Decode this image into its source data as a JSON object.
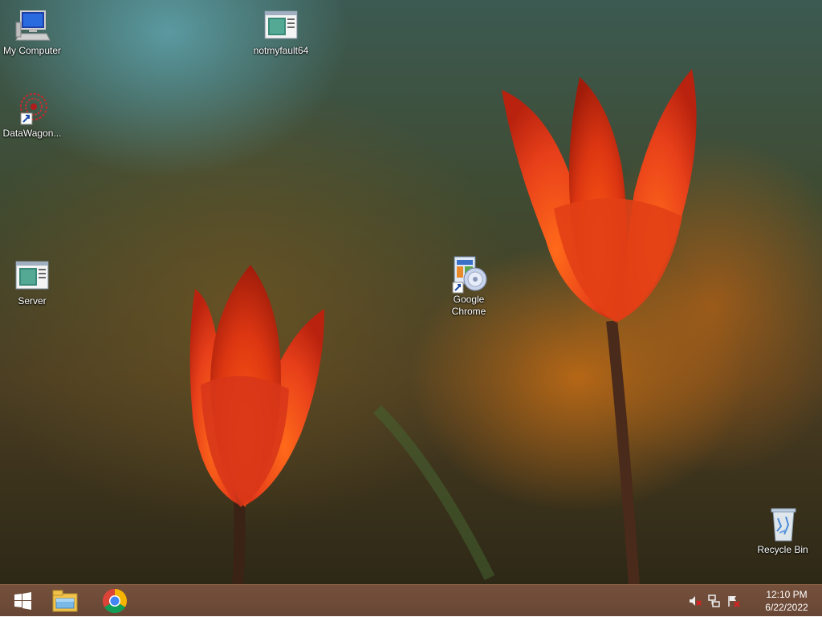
{
  "desktop": {
    "icons": [
      {
        "label": "My Computer",
        "icon": "computer-icon"
      },
      {
        "label": "notmyfault64",
        "icon": "application-window-icon"
      },
      {
        "label": "DataWagon...",
        "icon": "datawagon-shortcut-icon"
      },
      {
        "label": "Server",
        "icon": "application-window-icon"
      },
      {
        "label": "Google Chrome",
        "icon": "installer-cd-shortcut-icon"
      },
      {
        "label": "Recycle Bin",
        "icon": "recycle-bin-icon"
      }
    ]
  },
  "taskbar": {
    "start": {
      "icon": "windows-logo-icon"
    },
    "pinned": [
      {
        "name": "File Explorer",
        "icon": "file-explorer-icon"
      },
      {
        "name": "Google Chrome",
        "icon": "chrome-icon"
      }
    ],
    "tray": {
      "icons": [
        "speaker-muted-icon",
        "network-icon",
        "action-center-flag-icon"
      ],
      "time": "12:10 PM",
      "date": "6/22/2022"
    }
  },
  "colors": {
    "taskbar": "#6a4632",
    "tulip": "#e8401a",
    "label_text": "#ffffff"
  }
}
